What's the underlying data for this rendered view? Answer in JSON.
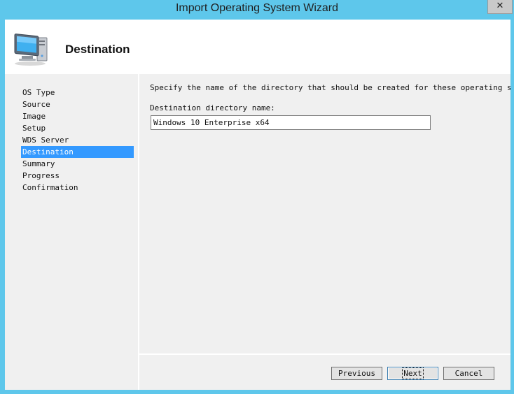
{
  "window": {
    "title": "Import Operating System Wizard",
    "close_glyph": "✕"
  },
  "header": {
    "title": "Destination",
    "icon": "computer-icon"
  },
  "nav": {
    "items": [
      {
        "label": "OS Type",
        "active": false
      },
      {
        "label": "Source",
        "active": false
      },
      {
        "label": "Image",
        "active": false
      },
      {
        "label": "Setup",
        "active": false
      },
      {
        "label": "WDS Server",
        "active": false
      },
      {
        "label": "Destination",
        "active": true
      },
      {
        "label": "Summary",
        "active": false
      },
      {
        "label": "Progress",
        "active": false
      },
      {
        "label": "Confirmation",
        "active": false
      }
    ]
  },
  "main": {
    "description": "Specify the name of the directory that should be created for these operating system fi",
    "dest_label": "Destination directory name:",
    "dest_value": "Windows 10 Enterprise x64"
  },
  "buttons": {
    "previous": "Previous",
    "next": "Next",
    "cancel": "Cancel"
  },
  "colors": {
    "titlebar": "#5ec7eb",
    "selection": "#3399ff",
    "panel": "#f0f0f0"
  }
}
